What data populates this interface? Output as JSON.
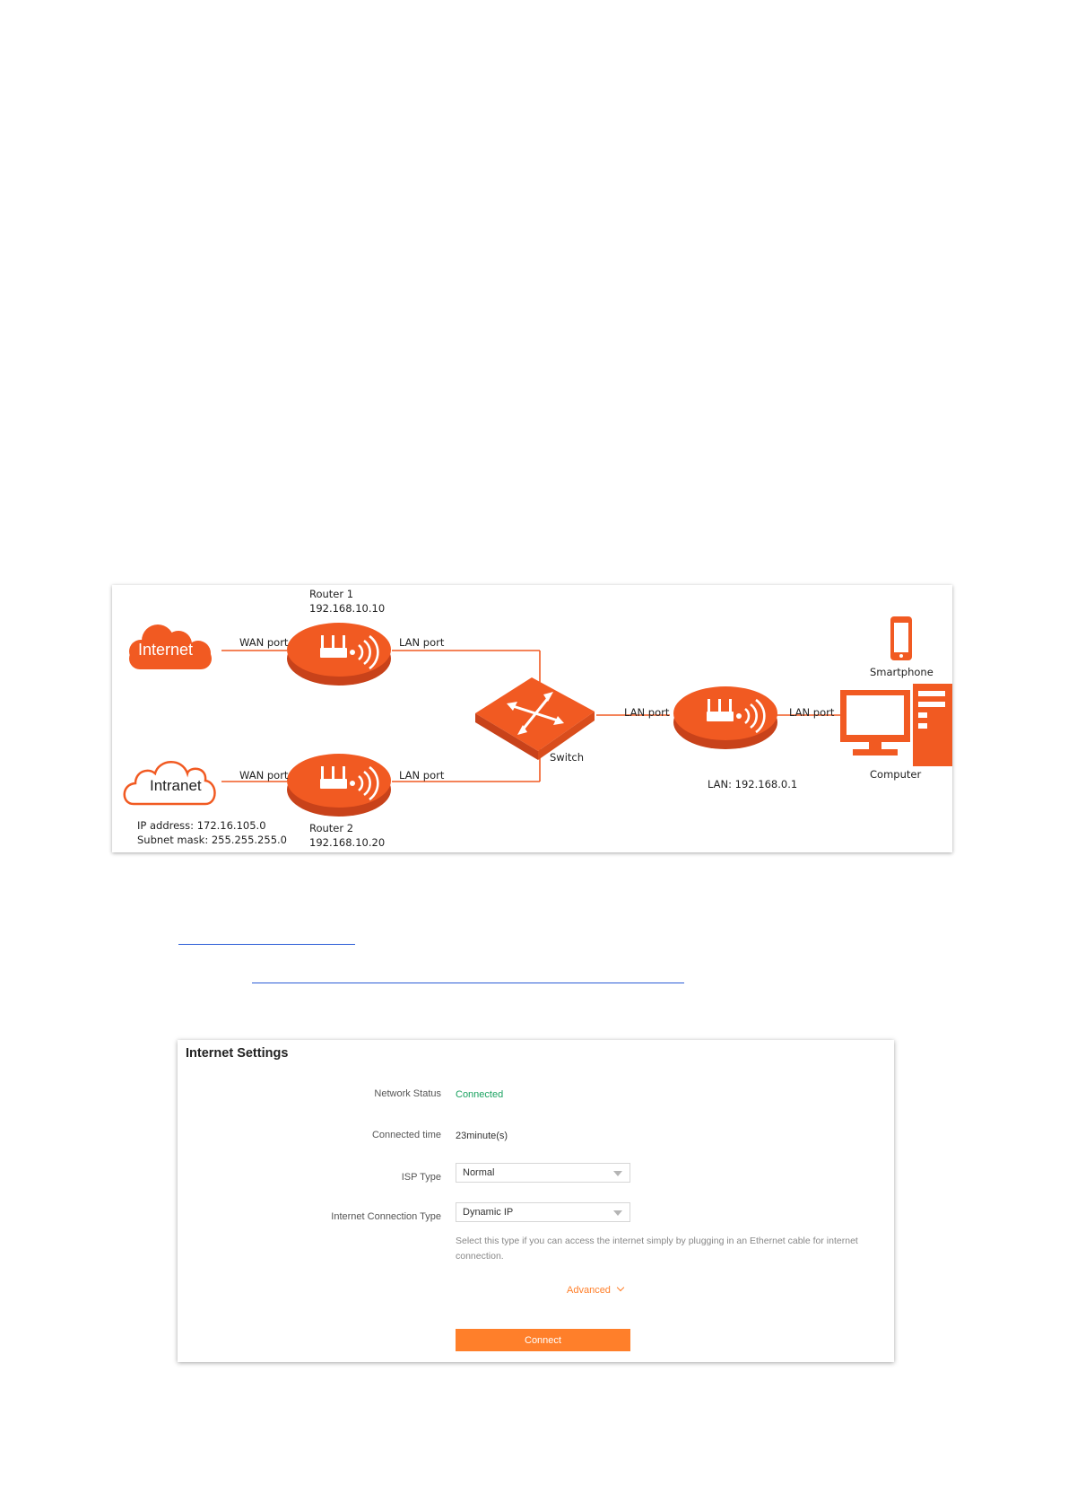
{
  "diagram": {
    "router1_name": "Router 1",
    "router1_ip": "192.168.10.10",
    "router2_name": "Router 2",
    "router2_ip": "192.168.10.20",
    "internet_label": "Internet",
    "intranet_label": "Intranet",
    "wan_port": "WAN port",
    "lan_port": "LAN port",
    "switch_label": "Switch",
    "smartphone_label": "Smartphone",
    "computer_label": "Computer",
    "lan_address": "LAN: 192.168.0.1",
    "intranet_ip": "IP address: 172.16.105.0",
    "intranet_mask": "Subnet mask: 255.255.255.0",
    "accent_color": "#f15a22"
  },
  "panel": {
    "title": "Internet Settings",
    "network_status_label": "Network Status",
    "network_status_value": "Connected",
    "connected_time_label": "Connected time",
    "connected_time_value": "23minute(s)",
    "isp_type_label": "ISP Type",
    "isp_type_value": "Normal",
    "connection_type_label": "Internet Connection Type",
    "connection_type_value": "Dynamic IP",
    "hint": "Select this type if you can access the internet simply by plugging in an Ethernet cable for internet connection.",
    "advanced_label": "Advanced",
    "connect_label": "Connect",
    "status_color": "#1aa260",
    "button_color": "#ff7f2a"
  }
}
